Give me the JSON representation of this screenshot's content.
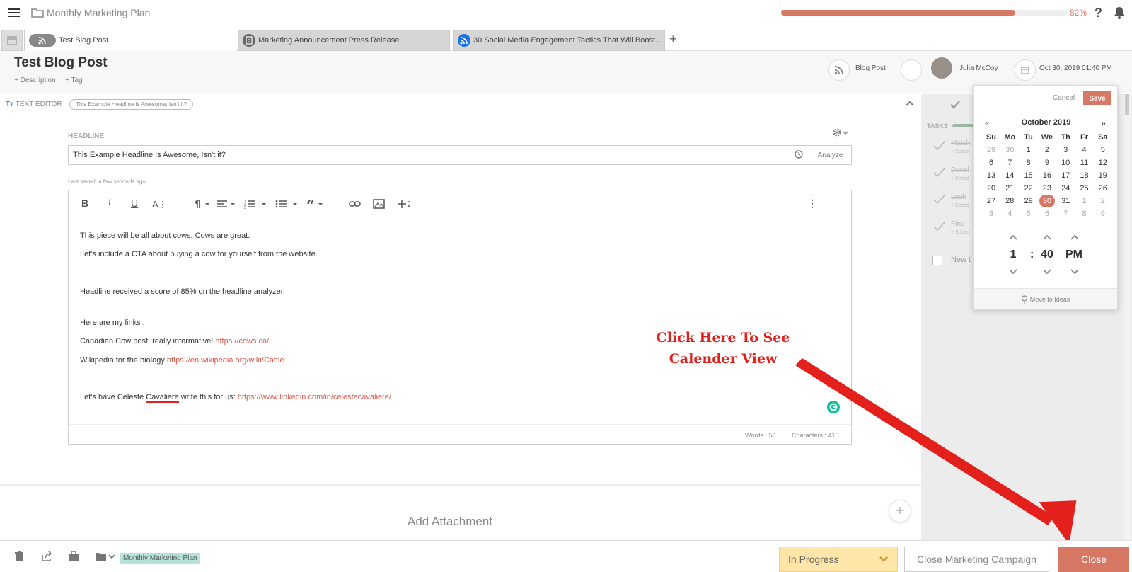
{
  "topbar": {
    "plan_title": "Monthly Marketing Plan",
    "progress_pct": 82,
    "progress_label": "82%",
    "help_glyph": "?"
  },
  "tabs": [
    {
      "label": "Test Blog Post",
      "active": true,
      "icon": "avatar-rss-icon"
    },
    {
      "label": "Marketing Announcement Press Release",
      "active": false,
      "icon": "document-icon"
    },
    {
      "label": "30 Social Media Engagement Tactics That Will Boost...",
      "active": false,
      "icon": "rss-icon"
    }
  ],
  "tab_add": "+",
  "header": {
    "title": "Test Blog Post",
    "add_description": "+ Description",
    "add_tag": "+ Tag",
    "content_type": "Blog Post",
    "owner": "Julia McCoy",
    "due_date": "Oct 30, 2019 01:40 PM"
  },
  "text_editor": {
    "label": "TEXT EDITOR",
    "pill": "This Example Headline Is Awesome, Isn't it?"
  },
  "headline": {
    "label": "HEADLINE",
    "value": "This Example Headline Is Awesome, Isn't it?",
    "analyze": "Analyze",
    "last_saved": "Last saved: a few seconds ago"
  },
  "toolbar": {
    "bold": "B",
    "italic": "i",
    "underline": "U",
    "more": "⋮"
  },
  "body": {
    "line1": "This piece will be all about cows. Cows are great.",
    "line2": "Let's include a CTA about buying a cow for yourself from the website.",
    "line3": "Headline received a score of 85% on the headline analyzer.",
    "line4": "Here are my links :",
    "line5_text": "Canadian Cow post, really informative! ",
    "line5_link": "https://cows.ca/",
    "line6_text": "Wikipedia for the biology ",
    "line6_link": "https://en.wikipedia.org/wiki/Cattle",
    "line7_a": "Let's have Celeste ",
    "line7_b": "Cavaliere",
    "line7_c": " write this for us: ",
    "line7_link": "https://www.linkedin.com/in/celestecavaliere/"
  },
  "counts": {
    "words": "Words : 58",
    "characters": "Characters : 410"
  },
  "attachments": {
    "label": "Add Attachment"
  },
  "tasks": {
    "label": "TASKS",
    "items": [
      {
        "name": "Match",
        "sub": "+ Sched"
      },
      {
        "name": "Devel",
        "sub": "+ Sched"
      },
      {
        "name": "Look",
        "sub": "+ Sched"
      },
      {
        "name": "Find",
        "sub": "+ Sched"
      }
    ],
    "new_task": "New t"
  },
  "datepicker": {
    "cancel": "Cancel",
    "save": "Save",
    "prev": "«",
    "next": "»",
    "month": "October 2019",
    "weekdays": [
      "Su",
      "Mo",
      "Tu",
      "We",
      "Th",
      "Fr",
      "Sa"
    ],
    "weeks": [
      [
        "29",
        "30",
        "1",
        "2",
        "3",
        "4",
        "5"
      ],
      [
        "6",
        "7",
        "8",
        "9",
        "10",
        "11",
        "12"
      ],
      [
        "13",
        "14",
        "15",
        "16",
        "17",
        "18",
        "19"
      ],
      [
        "20",
        "21",
        "22",
        "23",
        "24",
        "25",
        "26"
      ],
      [
        "27",
        "28",
        "29",
        "30",
        "31",
        "1",
        "2"
      ],
      [
        "3",
        "4",
        "5",
        "6",
        "7",
        "8",
        "9"
      ]
    ],
    "selected_day": "30",
    "hour": "1",
    "colon": ":",
    "minute": "40",
    "ampm": "PM",
    "footer": "Move to Ideas"
  },
  "annotation": {
    "line1": "Click Here To See",
    "line2": "Calender View",
    "color": "#e3201b"
  },
  "bottombar": {
    "campaign": "Monthly Marketing Plan",
    "status": "In Progress",
    "close_campaign": "Close Marketing Campaign",
    "close": "Close"
  },
  "colors": {
    "accent": "#d77865",
    "status_bg": "#fde6a8",
    "tag_bg": "#b5e3da",
    "link": "#d9584b"
  }
}
